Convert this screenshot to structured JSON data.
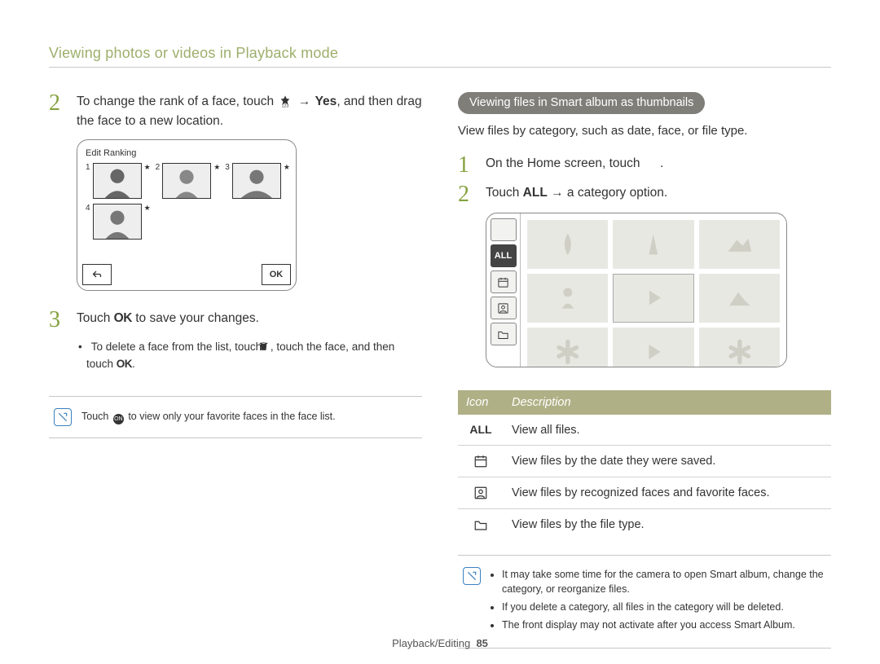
{
  "header": {
    "title": "Viewing photos or videos in Playback mode"
  },
  "left": {
    "step2": {
      "num": "2",
      "a": "To change the rank of a face, touch ",
      "b": " → ",
      "c": "Yes",
      "d": ", and then drag the face to a new location."
    },
    "editRanking": {
      "title": "Edit Ranking",
      "nums": [
        "1",
        "2",
        "3",
        "4"
      ],
      "ok": "OK"
    },
    "step3": {
      "num": "3",
      "a": "Touch ",
      "ok": "OK",
      "b": " to save your changes."
    },
    "bullet": {
      "a": "To delete a face from the list, touch ",
      "b": ", touch the face, and then touch ",
      "ok": "OK",
      "c": "."
    },
    "note": {
      "a": "Touch ",
      "b": " to view only your favorite faces in the face list."
    }
  },
  "right": {
    "pill": "Viewing files in Smart album as thumbnails",
    "subtext": "View files by category, such as date, face, or file type.",
    "step1": {
      "num": "1",
      "a": "On the Home screen, touch ",
      "b": "."
    },
    "step2": {
      "num": "2",
      "a": "Touch ",
      "all": "ALL",
      "b": " → a category option."
    },
    "sidebar": {
      "highlight": "ALL"
    },
    "table": {
      "head": {
        "icon": "Icon",
        "desc": "Description"
      },
      "rows": [
        {
          "iconType": "all",
          "iconText": "ALL",
          "desc": "View all files."
        },
        {
          "iconType": "calendar",
          "desc": "View files by the date they were saved."
        },
        {
          "iconType": "face",
          "desc": "View files by recognized faces and favorite faces."
        },
        {
          "iconType": "folder",
          "desc": "View files by the file type."
        }
      ]
    },
    "note2": [
      "It may take some time for the camera to open Smart album, change the category, or reorganize files.",
      "If you delete a category, all files in the category will be deleted.",
      "The front display may not activate after you access Smart Album."
    ]
  },
  "footer": {
    "section": "Playback/Editing",
    "page": "85"
  }
}
